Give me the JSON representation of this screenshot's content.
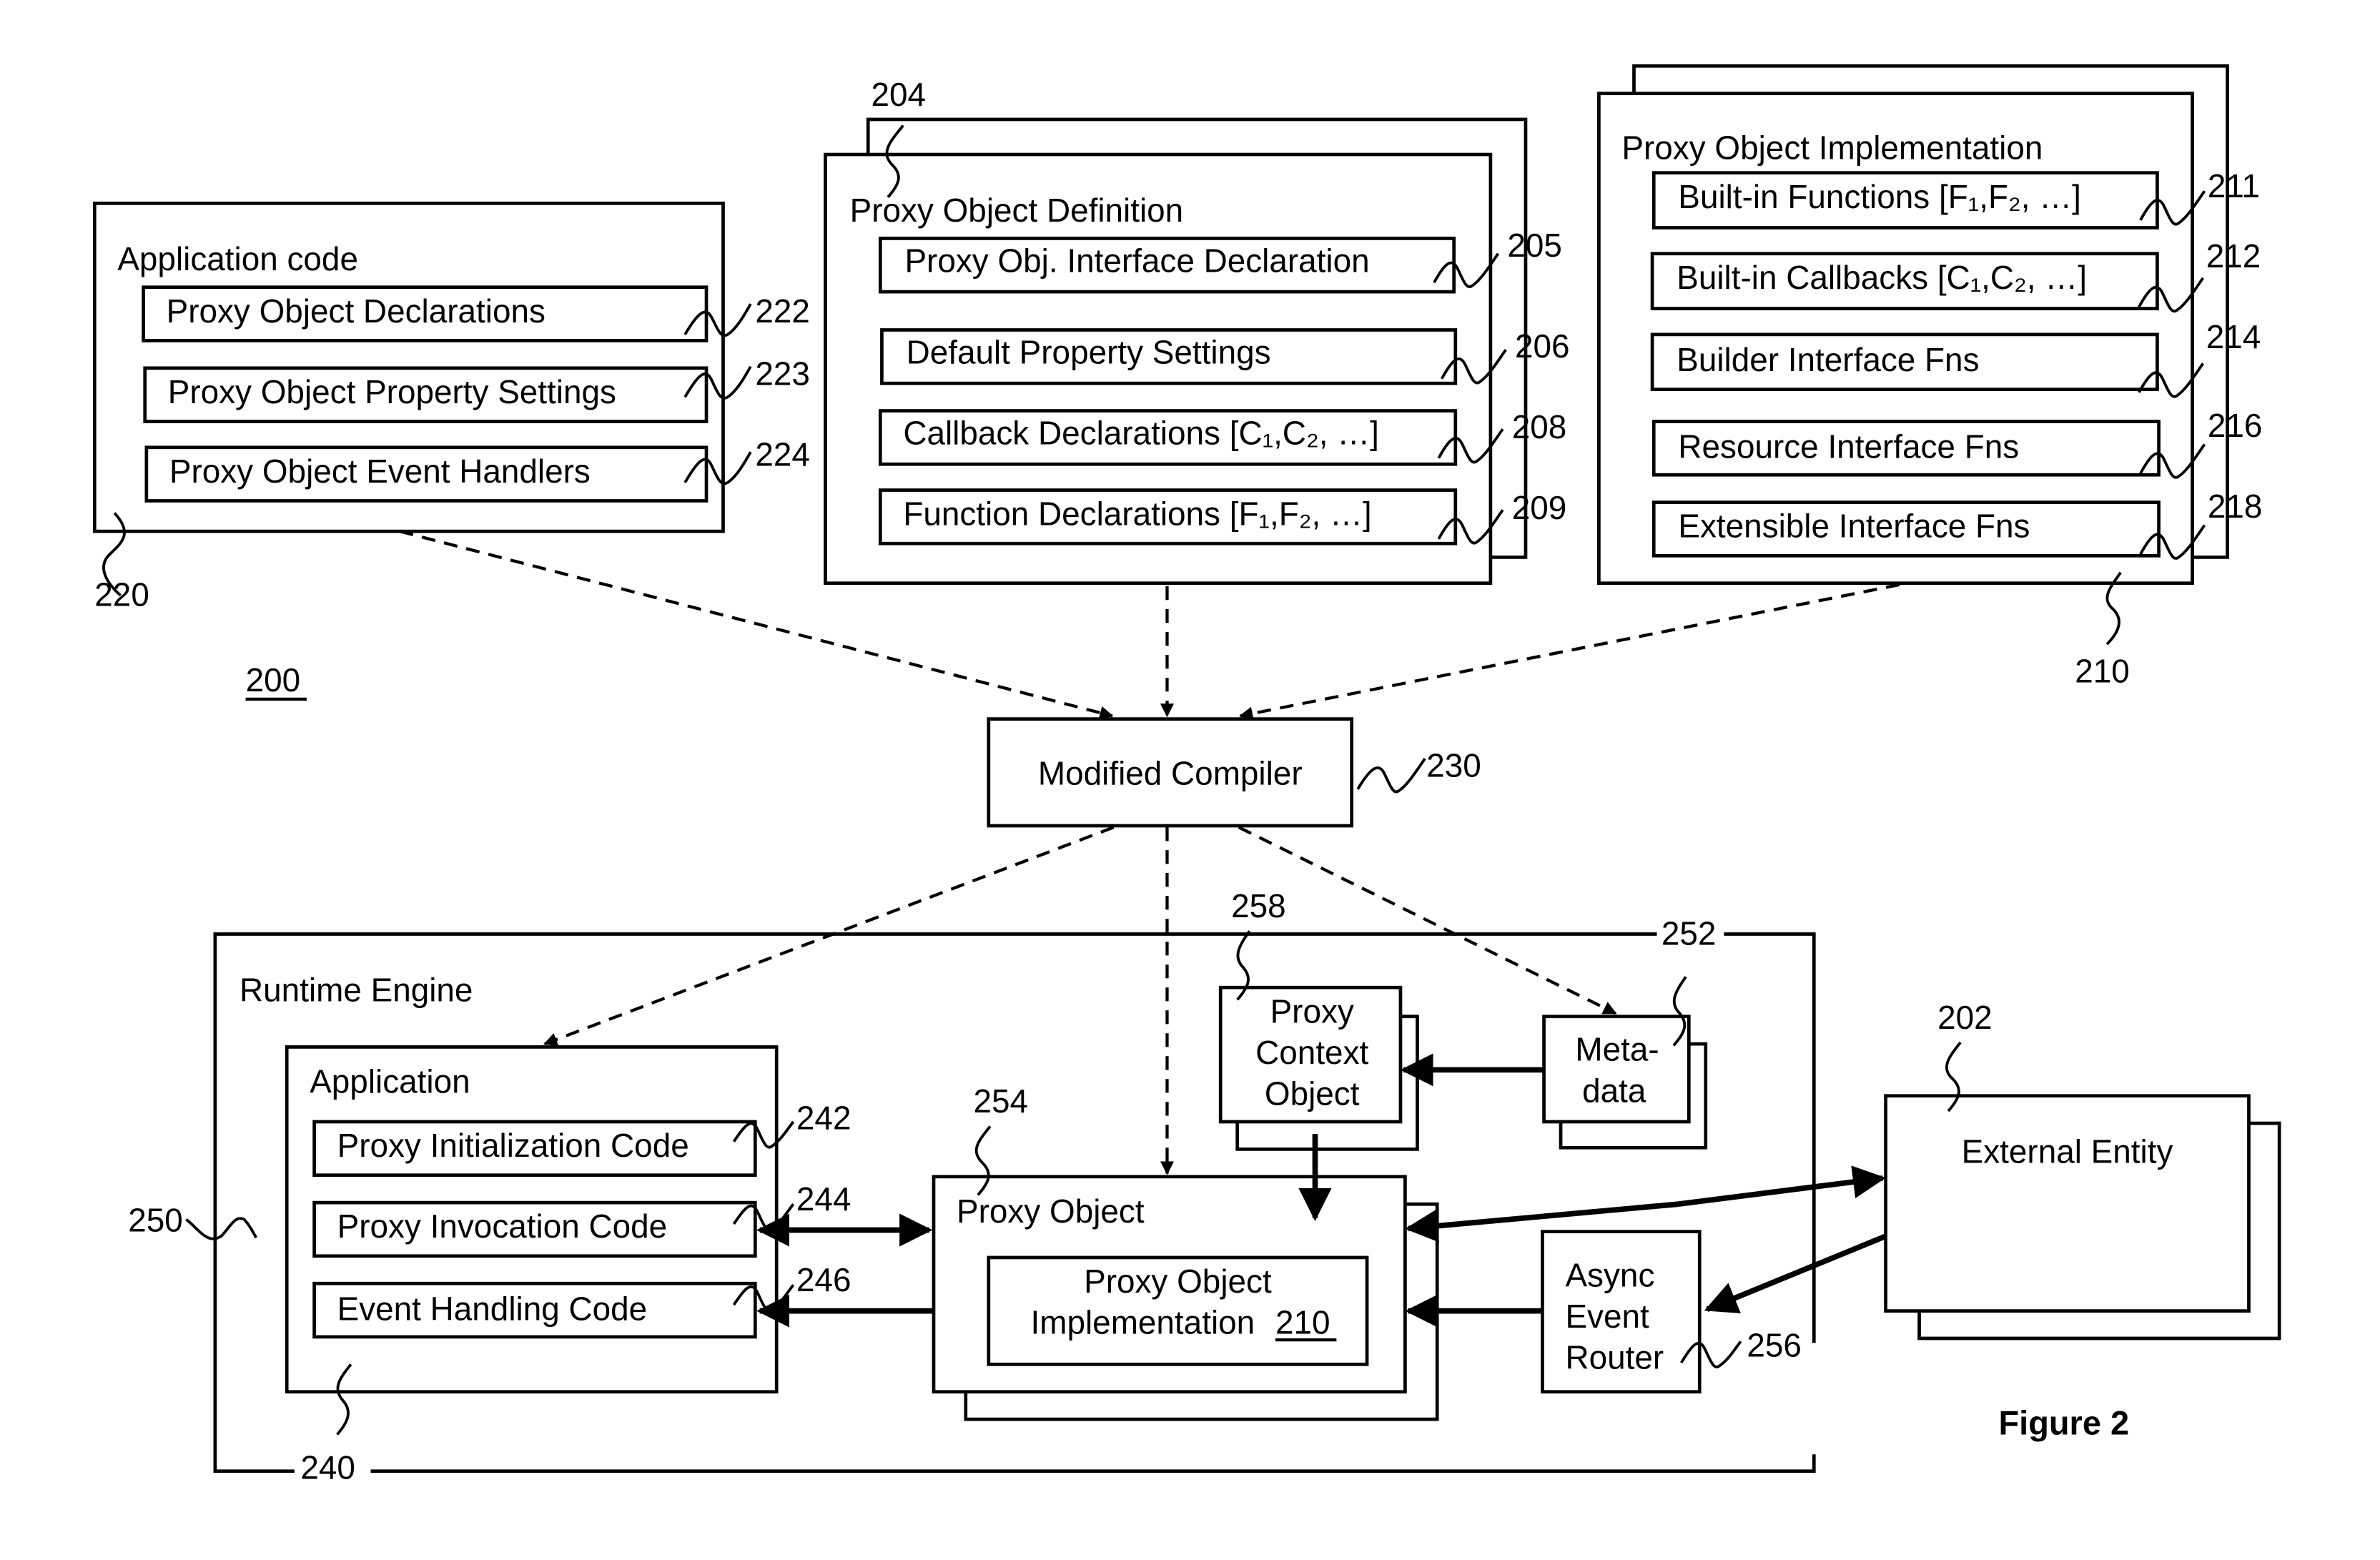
{
  "figure": {
    "caption": "Figure 2",
    "overall_ref": "200"
  },
  "app_code": {
    "title": "Application code",
    "ref": "220",
    "items": [
      {
        "label": "Proxy Object Declarations",
        "ref": "222"
      },
      {
        "label": "Proxy Object Property Settings",
        "ref": "223"
      },
      {
        "label": "Proxy Object Event Handlers",
        "ref": "224"
      }
    ]
  },
  "definition": {
    "title": "Proxy Object Definition",
    "ref": "204",
    "items": [
      {
        "label": "Proxy Obj. Interface Declaration",
        "ref": "205"
      },
      {
        "label": "Default Property Settings",
        "ref": "206"
      },
      {
        "label": "Callback Declarations [C₁,C₂, …]",
        "ref": "208"
      },
      {
        "label": "Function Declarations [F₁,F₂, …]",
        "ref": "209"
      }
    ]
  },
  "implementation": {
    "title": "Proxy Object Implementation",
    "ref": "210",
    "items": [
      {
        "label": "Built-in Functions [F₁,F₂, …]",
        "ref": "211"
      },
      {
        "label": "Built-in Callbacks [C₁,C₂, …]",
        "ref": "212"
      },
      {
        "label": "Builder Interface Fns",
        "ref": "214"
      },
      {
        "label": "Resource Interface Fns",
        "ref": "216"
      },
      {
        "label": "Extensible Interface Fns",
        "ref": "218"
      }
    ]
  },
  "compiler": {
    "label": "Modified Compiler",
    "ref": "230"
  },
  "runtime": {
    "title": "Runtime Engine",
    "ref": "250",
    "bottom_ref": "240",
    "application": {
      "title": "Application",
      "items": [
        {
          "label": "Proxy Initialization Code",
          "ref": "242"
        },
        {
          "label": "Proxy Invocation Code",
          "ref": "244"
        },
        {
          "label": "Event Handling Code",
          "ref": "246"
        }
      ]
    },
    "proxy_object": {
      "title": "Proxy Object",
      "ref": "254",
      "inner_line1": "Proxy Object",
      "inner_line2": "Implementation",
      "inner_ref": "210"
    },
    "context_object": {
      "line1": "Proxy",
      "line2": "Context",
      "line3": "Object",
      "ref": "258"
    },
    "metadata": {
      "line1": "Meta-",
      "line2": "data",
      "ref": "252"
    },
    "router": {
      "line1": "Async",
      "line2": "Event",
      "line3": "Router",
      "ref": "256"
    }
  },
  "external": {
    "label": "External Entity",
    "ref": "202"
  }
}
